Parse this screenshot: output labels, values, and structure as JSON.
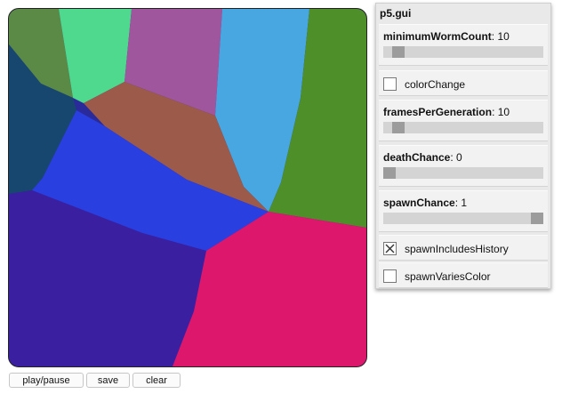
{
  "gui": {
    "title": "p5.gui",
    "controls": [
      {
        "label": "minimumWormCount",
        "type": "slider",
        "value": "10",
        "fraction": 0.06
      },
      {
        "label": "colorChange",
        "type": "checkbox",
        "checked": false
      },
      {
        "label": "framesPerGeneration",
        "type": "slider",
        "value": "10",
        "fraction": 0.06
      },
      {
        "label": "deathChance",
        "type": "slider",
        "value": "0",
        "fraction": 0.0
      },
      {
        "label": "spawnChance",
        "type": "slider",
        "value": "1",
        "fraction": 1.0
      },
      {
        "label": "spawnIncludesHistory",
        "type": "checkbox",
        "checked": true
      },
      {
        "label": "spawnVariesColor",
        "type": "checkbox",
        "checked": false
      }
    ]
  },
  "buttons": {
    "play_pause": "play/pause",
    "save": "save",
    "clear": "clear"
  },
  "canvas": {
    "region_colors": {
      "green_top_left": "#5a8a45",
      "teal_green": "#4fd98e",
      "purple": "#a0569c",
      "light_blue": "#48a7e0",
      "dark_teal": "#17476e",
      "brown": "#9b5a4a",
      "olive_green": "#4e8f29",
      "royal_blue": "#2a3fe0",
      "indigo": "#3a1fa0",
      "magenta": "#dd186c"
    }
  }
}
